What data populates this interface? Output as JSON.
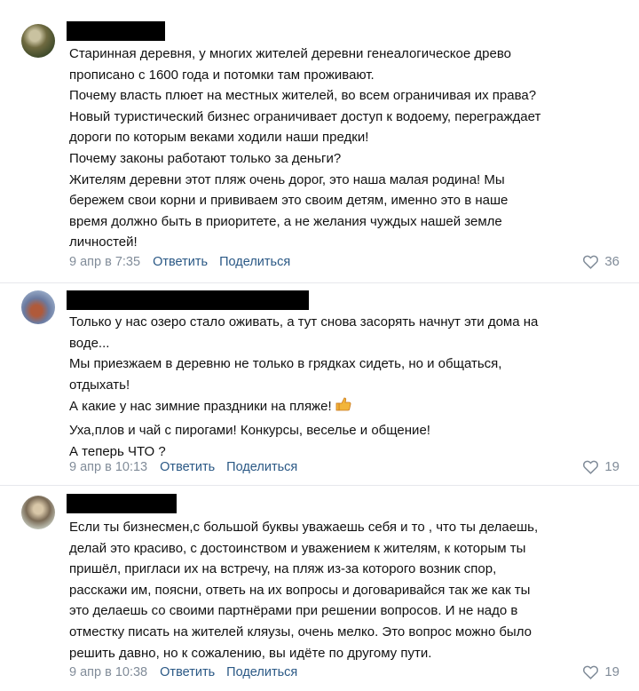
{
  "comments": [
    {
      "lines": [
        "Старинная деревня, у многих жителей деревни генеалогическое древо",
        "прописано с 1600 года и потомки там проживают.",
        "Почему власть плюет на местных жителей, во всем ограничивая их права?",
        "Новый туристический бизнес ограничивает доступ к водоему, переграждает",
        "дороги по которым веками ходили наши предки!",
        "Почему законы работают только за деньги?",
        "Жителям деревни этот пляж очень дорог, это наша малая родина! Мы",
        "бережем свои корни и прививаем это своим детям, именно это в наше",
        "время должно быть в приоритете, а не желания чуждых нашей земле",
        "личностей!"
      ],
      "date": "9 апр в 7:35",
      "reply": "Ответить",
      "share": "Поделиться",
      "likes": "36"
    },
    {
      "lines": [
        "Только у нас озеро стало оживать, а тут снова засорять начнут эти дома на",
        "воде...",
        "Мы приезжаем в деревню не только в грядках сидеть, но и общаться,",
        "отдыхать!",
        "А какие у нас зимние праздники на пляже!",
        "Уха,плов и чай с пирогами! Конкурсы, веселье и общение!",
        "А теперь ЧТО ?"
      ],
      "emoji": "thumbs-up-icon",
      "date": "9 апр в 10:13",
      "reply": "Ответить",
      "share": "Поделиться",
      "likes": "19"
    },
    {
      "lines": [
        "Если ты бизнесмен,с большой буквы уважаешь себя и то , что ты делаешь,",
        "делай это красиво, с достоинством и уважением к жителям, к которым ты",
        "пришёл, пригласи их на встречу, на пляж из-за которого возник спор,",
        "расскажи им, поясни, ответь на их вопросы и договаривайся так же как ты",
        "это делаешь со своими партнёрами при решении вопросов. И не надо в",
        "отместку писать на жителей кляузы, очень мелко. Это вопрос можно было",
        "решить давно, но к сожалению, вы идёте по другому пути."
      ],
      "date": "9 апр в 10:38",
      "reply": "Ответить",
      "share": "Поделиться",
      "likes": "19"
    }
  ],
  "colors": {
    "link": "#2a5885",
    "meta": "#818c99",
    "separator": "#e7e8ec"
  }
}
